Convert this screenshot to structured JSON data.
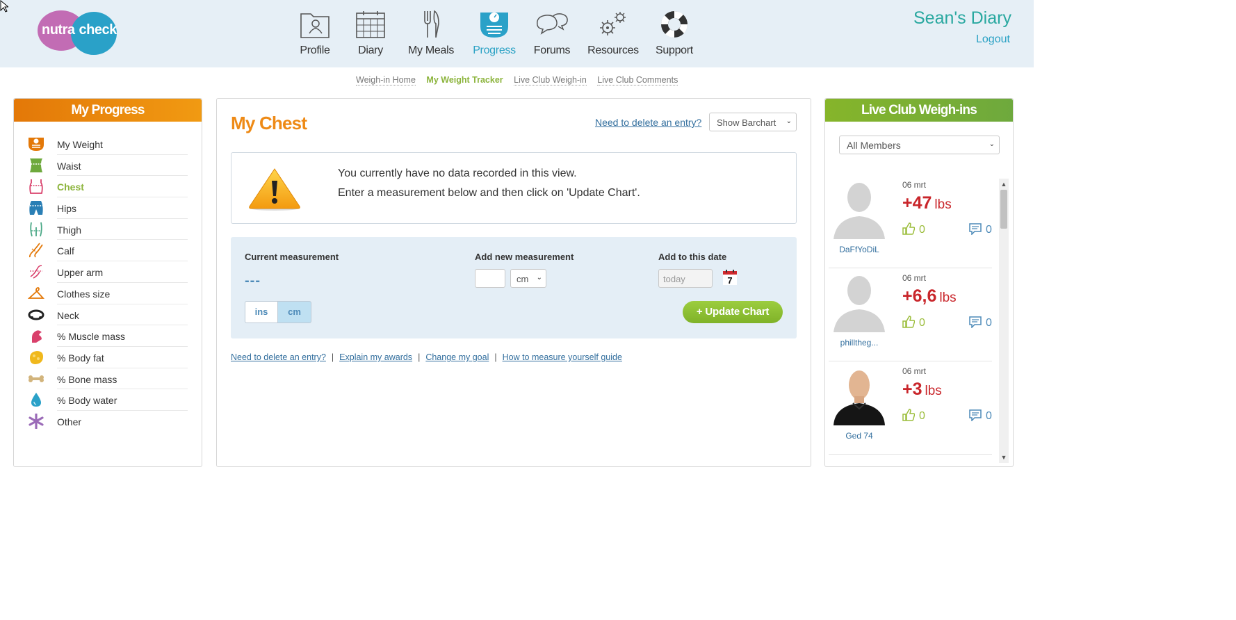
{
  "header": {
    "logo_left": "nutra",
    "logo_right": "check",
    "nav": [
      {
        "label": "Profile",
        "icon": "profile-icon",
        "active": false
      },
      {
        "label": "Diary",
        "icon": "calendar-icon",
        "active": false
      },
      {
        "label": "My Meals",
        "icon": "cutlery-icon",
        "active": false
      },
      {
        "label": "Progress",
        "icon": "scale-icon",
        "active": true
      },
      {
        "label": "Forums",
        "icon": "chat-bubbles-icon",
        "active": false
      },
      {
        "label": "Resources",
        "icon": "gears-icon",
        "active": false
      },
      {
        "label": "Support",
        "icon": "lifebuoy-icon",
        "active": false
      }
    ],
    "user_title": "Sean's Diary",
    "logout": "Logout"
  },
  "subnav": [
    "Weigh-in Home",
    "My Weight Tracker",
    "Live Club Weigh-in",
    "Live Club Comments"
  ],
  "left": {
    "title": "My Progress",
    "items": [
      {
        "label": "My Weight",
        "icon": "scale-icon",
        "color": "#e37808"
      },
      {
        "label": "Waist",
        "icon": "waist-icon",
        "color": "#6ea93d"
      },
      {
        "label": "Chest",
        "icon": "chest-icon",
        "color": "#d9406b"
      },
      {
        "label": "Hips",
        "icon": "hips-icon",
        "color": "#2a7fb5"
      },
      {
        "label": "Thigh",
        "icon": "thigh-icon",
        "color": "#4aa886"
      },
      {
        "label": "Calf",
        "icon": "calf-icon",
        "color": "#e37808"
      },
      {
        "label": "Upper arm",
        "icon": "upper-arm-icon",
        "color": "#d9406b"
      },
      {
        "label": "Clothes size",
        "icon": "hanger-icon",
        "color": "#e37808"
      },
      {
        "label": "Neck",
        "icon": "neck-icon",
        "color": "#222222"
      },
      {
        "label": "% Muscle mass",
        "icon": "muscle-icon",
        "color": "#d9406b"
      },
      {
        "label": "% Body fat",
        "icon": "fat-icon",
        "color": "#f0b81c"
      },
      {
        "label": "% Bone mass",
        "icon": "bone-icon",
        "color": "#d2b47c"
      },
      {
        "label": "% Body water",
        "icon": "water-drop-icon",
        "color": "#2aa1c8"
      },
      {
        "label": "Other",
        "icon": "asterisk-icon",
        "color": "#9b6bb8"
      }
    ]
  },
  "center": {
    "title": "My Chest",
    "need_delete": "Need to delete an entry?",
    "chart_select": "Show Barchart",
    "alert_line1": "You currently have no data recorded in this view.",
    "alert_line2": "Enter a measurement below and then click on 'Update Chart'.",
    "current_label": "Current measurement",
    "current_value": "---",
    "add_label": "Add new measurement",
    "unit_select": "cm",
    "date_label": "Add to this date",
    "date_placeholder": "today",
    "calendar_day": "7",
    "unit_ins": "ins",
    "unit_cm": "cm",
    "update_button": "+ Update Chart",
    "links": [
      "Need to delete an entry?",
      "Explain my awards",
      "Change my goal",
      "How to measure yourself guide"
    ]
  },
  "right": {
    "title": "Live Club Weigh-ins",
    "members_select": "All Members",
    "feed": [
      {
        "date": "06 mrt",
        "change": "+47",
        "unit": "lbs",
        "likes": "0",
        "comments": "0",
        "name": "DaFfYoDiL",
        "avatar": "default-avatar"
      },
      {
        "date": "06 mrt",
        "change": "+6,6",
        "unit": "lbs",
        "likes": "0",
        "comments": "0",
        "name": "phillthеg...",
        "avatar": "default-avatar"
      },
      {
        "date": "06 mrt",
        "change": "+3",
        "unit": "lbs",
        "likes": "0",
        "comments": "0",
        "name": "Ged 74",
        "avatar": "photo-avatar"
      }
    ]
  }
}
